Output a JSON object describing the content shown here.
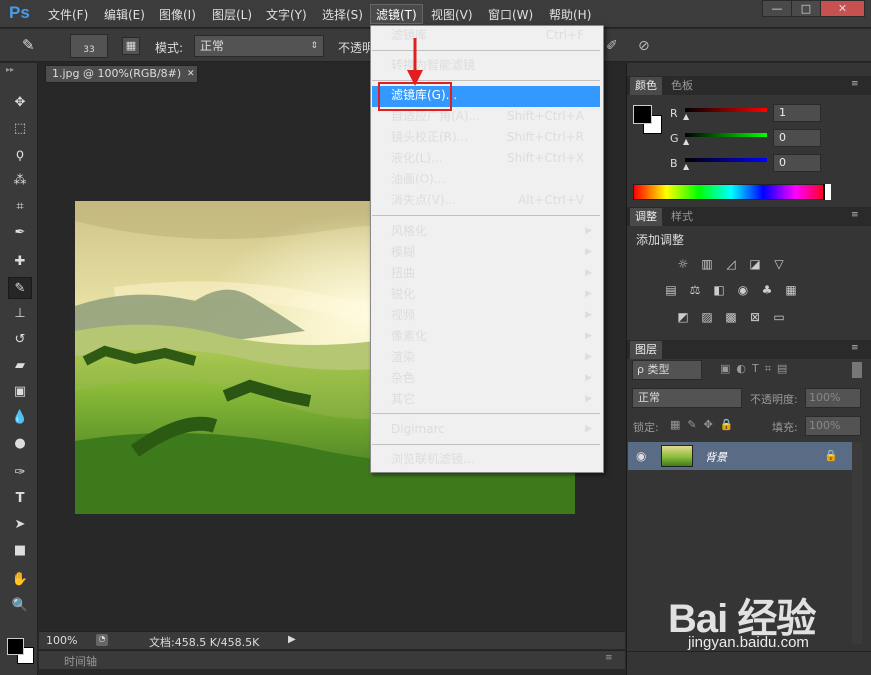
{
  "app": {
    "logo": "Ps"
  },
  "menubar": {
    "items": [
      "文件(F)",
      "编辑(E)",
      "图像(I)",
      "图层(L)",
      "文字(Y)",
      "选择(S)",
      "滤镜(T)",
      "视图(V)",
      "窗口(W)",
      "帮助(H)"
    ],
    "active": "滤镜(T)",
    "win_min": "—",
    "win_max": "□",
    "win_close": "✕"
  },
  "options": {
    "brush_size": "33",
    "mode_label": "模式:",
    "mode_value": "正常",
    "opacity_label": "不透明"
  },
  "document": {
    "tab": "1.jpg @ 100%(RGB/8#)",
    "tab_close": "✕",
    "zoom": "100%",
    "doc_info": "文档:458.5 K/458.5K",
    "timeline": "时间轴"
  },
  "color_panel": {
    "tabs": [
      "颜色",
      "色板"
    ],
    "r_label": "R",
    "g_label": "G",
    "b_label": "B",
    "r": "1",
    "g": "0",
    "b": "0",
    "fg_color": "#010000",
    "bg_color": "#ffffff"
  },
  "adjust_panel": {
    "tabs": [
      "调整",
      "样式"
    ],
    "title": "添加调整"
  },
  "layers_panel": {
    "tabs": [
      "图层"
    ],
    "filter_label": "ρ 类型",
    "blend": "正常",
    "opacity_label": "不透明度:",
    "opacity": "100%",
    "lock_label": "锁定:",
    "fill_label": "填充:",
    "fill": "100%",
    "layer_name": "背景"
  },
  "filter_menu": {
    "items": [
      {
        "label": "滤镜库",
        "shortcut": "Ctrl+F"
      },
      {
        "label": "转换为智能滤镜",
        "shortcut": ""
      },
      {
        "label": "滤镜库(G)...",
        "shortcut": "",
        "highlight": true
      },
      {
        "label": "自适应广角(A)...",
        "shortcut": "Shift+Ctrl+A"
      },
      {
        "label": "镜头校正(R)...",
        "shortcut": "Shift+Ctrl+R"
      },
      {
        "label": "液化(L)...",
        "shortcut": "Shift+Ctrl+X"
      },
      {
        "label": "油画(O)...",
        "shortcut": ""
      },
      {
        "label": "消失点(V)...",
        "shortcut": "Alt+Ctrl+V"
      },
      {
        "label": "风格化",
        "submenu": true
      },
      {
        "label": "模糊",
        "submenu": true
      },
      {
        "label": "扭曲",
        "submenu": true
      },
      {
        "label": "锐化",
        "submenu": true
      },
      {
        "label": "视频",
        "submenu": true
      },
      {
        "label": "像素化",
        "submenu": true
      },
      {
        "label": "渲染",
        "submenu": true
      },
      {
        "label": "杂色",
        "submenu": true
      },
      {
        "label": "其它",
        "submenu": true
      },
      {
        "label": "Digimarc",
        "submenu": true
      },
      {
        "label": "浏览联机滤镜..."
      }
    ]
  },
  "watermark": {
    "text": "Bai 经验",
    "url": "jingyan.baidu.com"
  },
  "colors": {
    "accent": "#3399ff",
    "annotation": "#e02020"
  }
}
